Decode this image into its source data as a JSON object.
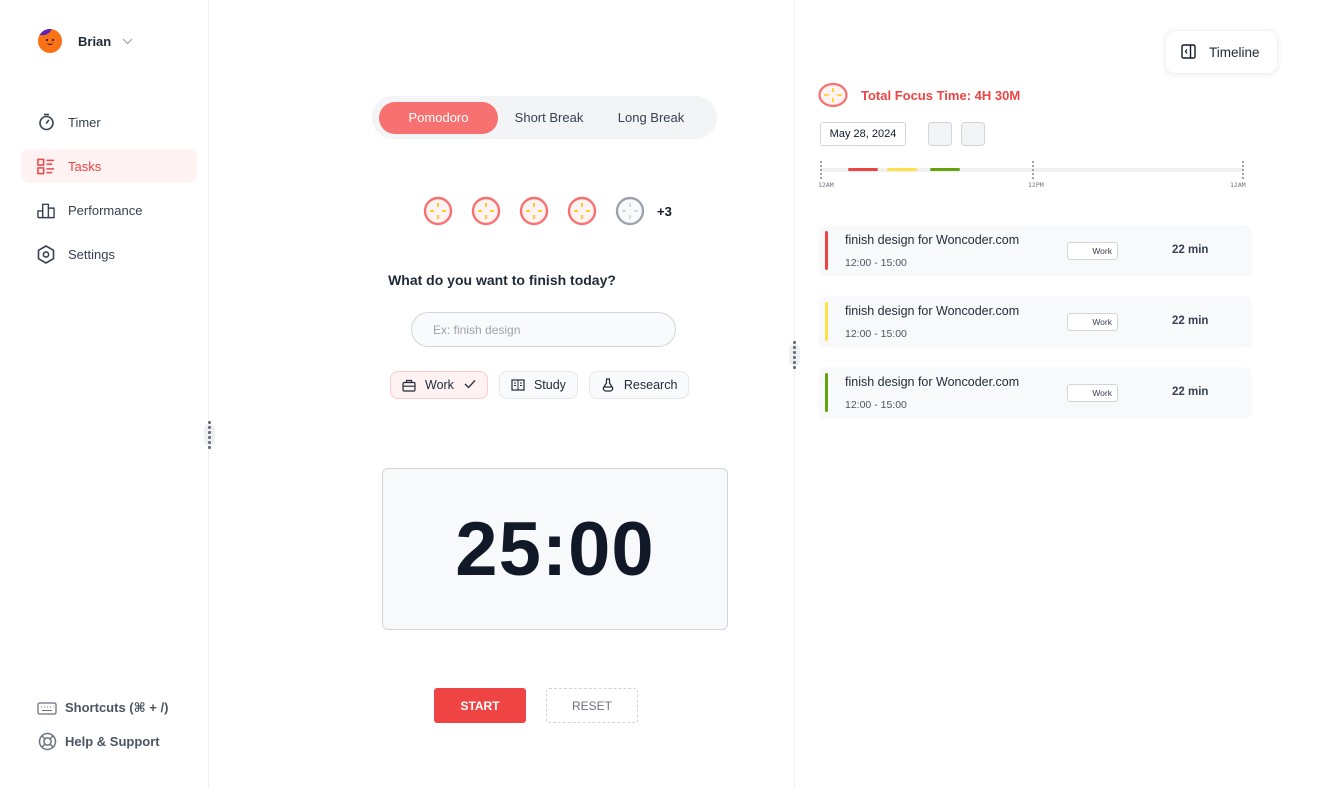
{
  "user": {
    "name": "Brian"
  },
  "sidebar": {
    "items": [
      {
        "label": "Timer",
        "icon": "stopwatch-icon",
        "active": false
      },
      {
        "label": "Tasks",
        "icon": "tasks-list-icon",
        "active": true
      },
      {
        "label": "Performance",
        "icon": "bar-chart-icon",
        "active": false
      },
      {
        "label": "Settings",
        "icon": "hexagon-gear-icon",
        "active": false
      }
    ],
    "bottom": [
      {
        "label": "Shortcuts (⌘ + /)",
        "icon": "keyboard-icon"
      },
      {
        "label": "Help & Support",
        "icon": "lifebuoy-icon"
      }
    ]
  },
  "main": {
    "modes": [
      {
        "label": "Pomodoro",
        "active": true
      },
      {
        "label": "Short Break",
        "active": false
      },
      {
        "label": "Long Break",
        "active": false
      }
    ],
    "pomodoros": {
      "completed": 4,
      "pending": 1,
      "more_label": "+3"
    },
    "question": "What do you want to finish today?",
    "task_input": {
      "placeholder": "Ex: finish design",
      "value": ""
    },
    "categories": [
      {
        "label": "Work",
        "icon": "briefcase-icon",
        "selected": true
      },
      {
        "label": "Study",
        "icon": "book-icon",
        "selected": false
      },
      {
        "label": "Research",
        "icon": "flask-icon",
        "selected": false
      }
    ],
    "timer": "25:00",
    "start_label": "START",
    "reset_label": "RESET"
  },
  "right": {
    "timeline_button": "Timeline",
    "total_focus": "Total Focus Time: 4H 30M",
    "date": "May 28, 2024",
    "axis_labels": [
      "12AM",
      "12PM",
      "12AM"
    ],
    "segments": [
      {
        "start_hour": 1.6,
        "end_hour": 3.3,
        "color": "#ef4444"
      },
      {
        "start_hour": 3.8,
        "end_hour": 5.5,
        "color": "#fde047"
      },
      {
        "start_hour": 6.2,
        "end_hour": 7.9,
        "color": "#65a30d"
      }
    ],
    "sessions": [
      {
        "title": "finish design for Woncoder.com",
        "time": "12:00 - 15:00",
        "tag": "Work",
        "duration": "22 min",
        "color": "#ef4444"
      },
      {
        "title": "finish design for Woncoder.com",
        "time": "12:00 - 15:00",
        "tag": "Work",
        "duration": "22 min",
        "color": "#fde047"
      },
      {
        "title": "finish design for Woncoder.com",
        "time": "12:00 - 15:00",
        "tag": "Work",
        "duration": "22 min",
        "color": "#65a30d"
      }
    ]
  },
  "colors": {
    "accent": "#ef4444",
    "accent_soft": "#f87171",
    "active_bg": "#fef2f2",
    "pomo_cross": "#facc15",
    "pomo_pending": "#9ca3af"
  }
}
